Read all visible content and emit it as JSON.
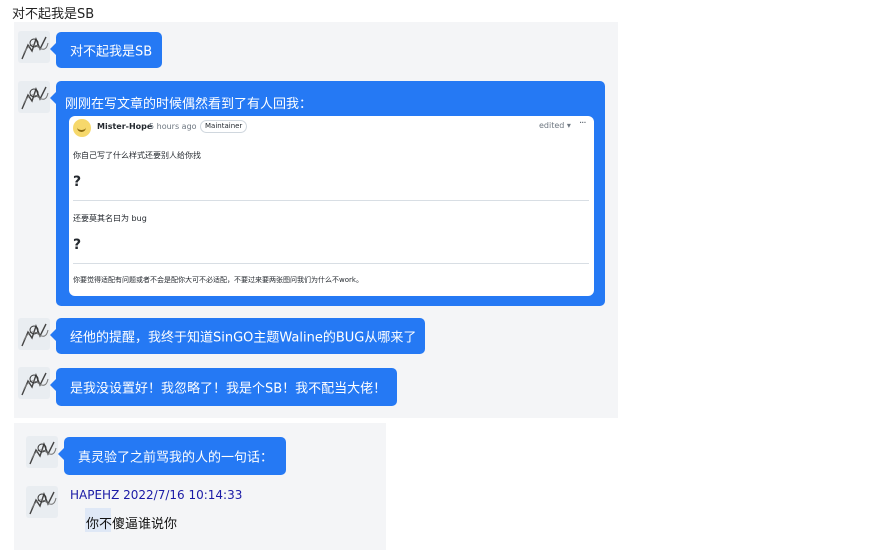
{
  "page": {
    "title": "对不起我是SB"
  },
  "messages": {
    "m1": "对不起我是SB",
    "m2_title": "刚刚在写文章的时候偶然看到了有人回我：",
    "m3": "经他的提醒，我终于知道SinGO主题Waline的BUG从哪来了",
    "m4": "是我没设置好！我忽略了！我是个SB！我不配当大佬！",
    "m5": "真灵验了之前骂我的人的一句话："
  },
  "quoted_comment": {
    "author": "Mister-Hope",
    "time": "5 hours ago",
    "role_badge": "Maintainer",
    "edited": "edited ▾",
    "more": "···",
    "line1": "你自己写了什么样式还要别人给你找",
    "q1": "?",
    "line2": "还要莫其名曰为 bug",
    "q2": "?",
    "line3": "你要觉得适配有问题或者不会是配你大可不必适配，不要过来要两张图问我们为什么不work。"
  },
  "reply": {
    "author_line": "HAPEHZ 2022/7/16 10:14:33",
    "text": "你不傻逼谁说你"
  },
  "colors": {
    "bubble": "#2579f4",
    "panel": "#f4f5f7",
    "reply_author": "#1a1aa6"
  },
  "icons": {
    "avatar": "sketch-avatar-icon",
    "comment_avatar": "smiley-avatar-icon",
    "more": "more-horizontal-icon"
  }
}
